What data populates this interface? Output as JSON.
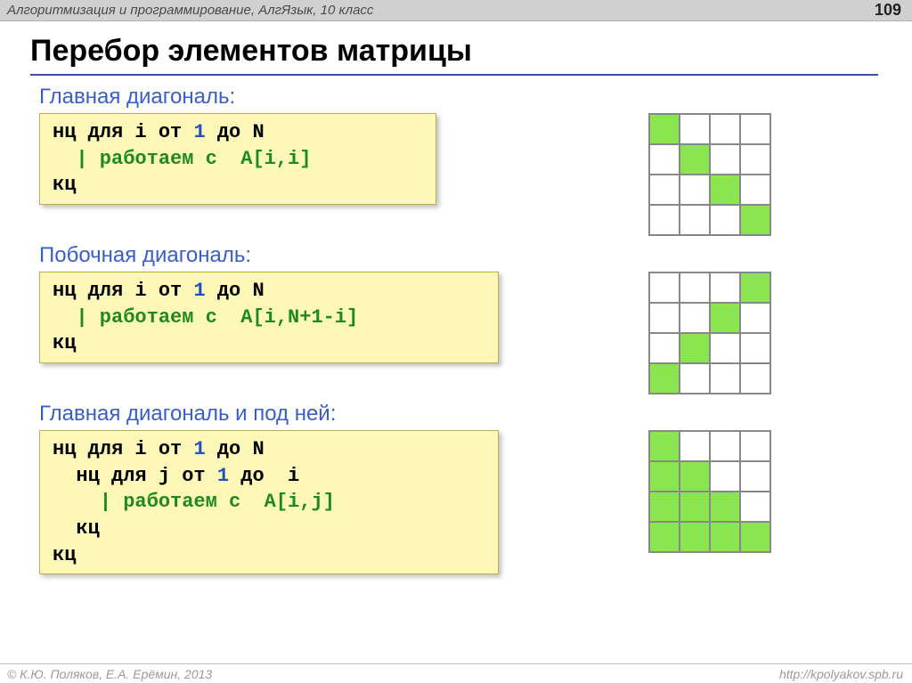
{
  "topbar": {
    "breadcrumb": "Алгоритмизация и программирование, АлгЯзык, 10 класс",
    "page_number": "109"
  },
  "title": "Перебор элементов матрицы",
  "sections": [
    {
      "heading": "Главная диагональ:",
      "code_html": "нц для i от <span class='num'>1</span> до N\n  <span class='comm'>| работаем с  A[i,i]</span>\nкц",
      "grid_pattern": "main"
    },
    {
      "heading": "Побочная диагональ:",
      "code_html": "нц для i от <span class='num'>1</span> до N\n  <span class='comm'>| работаем с  A[i,N+1-i]</span>\nкц",
      "grid_pattern": "anti"
    },
    {
      "heading": "Главная диагональ и под ней:",
      "code_html": "нц для i от <span class='num'>1</span> до N\n  нц для j от <span class='num'>1</span> до  i\n    <span class='comm'>| работаем с  A[i,j]</span>\n  кц\nкц",
      "grid_pattern": "lower"
    }
  ],
  "footer": {
    "copyright": "© К.Ю. Поляков, Е.А. Ерёмин, 2013",
    "url": "http://kpolyakov.spb.ru"
  },
  "code_widths": [
    "w1",
    "w2",
    "w2"
  ],
  "grid_offsets": [
    200,
    130,
    130
  ]
}
